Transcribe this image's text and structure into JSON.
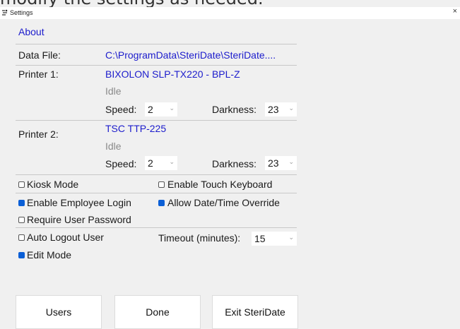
{
  "background_caption": "modify the settings as needed.",
  "window": {
    "title": "Settings",
    "close_glyph": "×",
    "icon": "settings-app-icon"
  },
  "about_link": "About",
  "data_file": {
    "label": "Data File:",
    "value": "C:\\ProgramData\\SteriDate\\SteriDate...."
  },
  "printer1": {
    "label": "Printer 1:",
    "name": "BIXOLON SLP-TX220 - BPL-Z",
    "status": "Idle",
    "speed_label": "Speed:",
    "speed_value": "2",
    "darkness_label": "Darkness:",
    "darkness_value": "23"
  },
  "printer2": {
    "label": "Printer 2:",
    "name": "TSC TTP-225",
    "status": "Idle",
    "speed_label": "Speed:",
    "speed_value": "2",
    "darkness_label": "Darkness:",
    "darkness_value": "23"
  },
  "options": {
    "kiosk_mode": {
      "label": "Kiosk Mode",
      "checked": false
    },
    "touch_keyboard": {
      "label": "Enable Touch Keyboard",
      "checked": false
    },
    "employee_login": {
      "label": "Enable Employee Login",
      "checked": true
    },
    "date_override": {
      "label": "Allow Date/Time Override",
      "checked": true
    },
    "require_password": {
      "label": "Require User Password",
      "checked": false
    },
    "auto_logout": {
      "label": "Auto Logout User",
      "checked": false
    },
    "timeout_label": "Timeout (minutes):",
    "timeout_value": "15",
    "edit_mode": {
      "label": "Edit Mode",
      "checked": true
    }
  },
  "buttons": {
    "users": "Users",
    "done": "Done",
    "exit": "Exit SteriDate"
  },
  "chevron_glyph": "⌄",
  "colors": {
    "link_blue": "#1c1ccc",
    "checkbox_checked": "#0b5fd6",
    "status_gray": "#8a8a8a"
  }
}
